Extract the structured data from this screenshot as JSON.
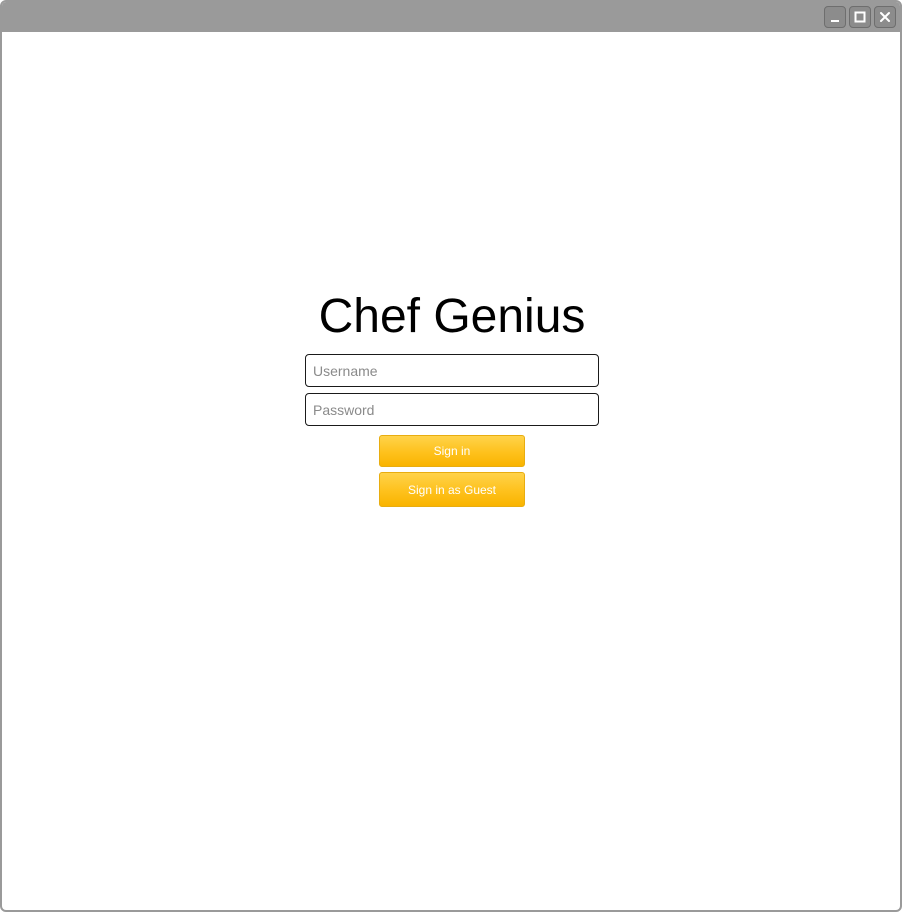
{
  "window": {
    "controls": [
      {
        "name": "minimize",
        "icon": "minimize-icon"
      },
      {
        "name": "maximize",
        "icon": "maximize-icon"
      },
      {
        "name": "close",
        "icon": "close-icon"
      }
    ],
    "titlebar_color": "#9a9a9a"
  },
  "login": {
    "title": "Chef Genius",
    "username_placeholder": "Username",
    "password_placeholder": "Password",
    "signin_label": "Sign in",
    "guest_label": "Sign in as Guest",
    "accent_color": "#fec11c"
  }
}
